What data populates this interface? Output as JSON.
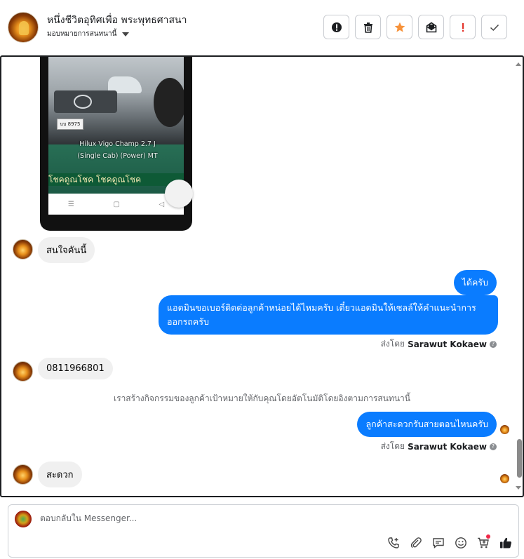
{
  "header": {
    "page_name": "หนึ่งชีวิตอุทิศเพื่อ พระพุทธศาสนา",
    "assign_label": "มอบหมายการสนทนานี้",
    "actions": [
      {
        "name": "report-spam-button",
        "icon": "exclamation-circle-icon"
      },
      {
        "name": "delete-button",
        "icon": "trash-icon"
      },
      {
        "name": "star-button",
        "icon": "star-icon"
      },
      {
        "name": "mark-unread-button",
        "icon": "envelope-icon"
      },
      {
        "name": "follow-up-button",
        "icon": "exclamation-icon"
      },
      {
        "name": "mark-done-button",
        "icon": "check-icon"
      }
    ]
  },
  "image_message": {
    "plate": "บบ 8975",
    "model_line1": "Hilux Vigo Champ 2.7 J",
    "model_line2": "(Single Cab) (Power) MT",
    "banner": "โชคดูณโชค โชคดูณโชค",
    "nav_glyphs": [
      "☰",
      "▢",
      "◁"
    ]
  },
  "messages": {
    "in_1": "สนใจคันนี้",
    "out_1": "ได้ครับ",
    "out_2": "แอดมินขอเบอร์ติดต่อลูกค้าหน่อยได้ไหมครับ เดี๋ยวแอดมินให้เซลล์ให้คำแนะนำการออกรถครับ",
    "sent_by_label": "ส่งโดย",
    "sent_by_name_1": "Sarawut Kokaew",
    "in_2": "0811966801",
    "system": "เราสร้างกิจกรรมของลูกค้าเป้าหมายให้กับคุณโดยอัตโนมัติโดยอิงตามการสนทนานี้",
    "out_3": "ลูกค้าสะดวกรับสายตอนไหนครับ",
    "sent_by_name_2": "Sarawut Kokaew",
    "in_3": "สะดวก"
  },
  "composer": {
    "placeholder": "ตอบกลับใน Messenger...",
    "tools": [
      "phone-plus-icon",
      "paperclip-icon",
      "saved-reply-icon",
      "emoji-icon",
      "cart-icon",
      "thumbs-up-icon"
    ]
  },
  "colors": {
    "outgoing": "#0a7cff",
    "incoming": "#f0f0f0",
    "star": "#f7923a",
    "follow_up": "#e4332b"
  }
}
